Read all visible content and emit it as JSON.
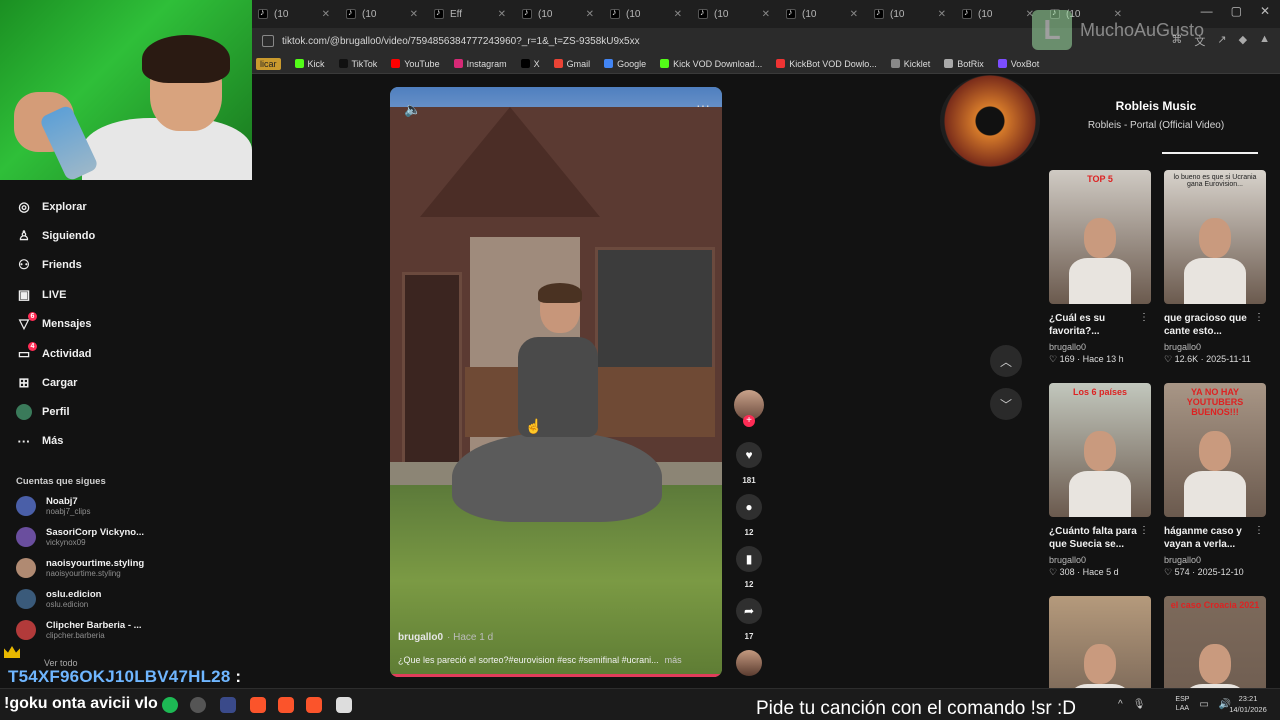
{
  "browser": {
    "tab_label": "(10",
    "tab_special_label": "Eff",
    "url": "tiktok.com/@brugallo0/video/7594856384777243960?_r=1&_t=ZS-9358kU9x5xx",
    "bookmarks": [
      "licar",
      "Kick",
      "TikTok",
      "YouTube",
      "Instagram",
      "X",
      "Gmail",
      "Google",
      "Kick VOD Download...",
      "KickBot VOD Dowlo...",
      "Kicklet",
      "BotRix",
      "VoxBot"
    ]
  },
  "sidebar": {
    "nav": [
      "Explorar",
      "Siguiendo",
      "Friends",
      "LIVE",
      "Mensajes",
      "Actividad",
      "Cargar",
      "Perfil",
      "Más"
    ],
    "badges": {
      "mensajes": "6",
      "actividad": "4"
    },
    "follow_title": "Cuentas que sigues",
    "following": [
      {
        "name": "Noabj7",
        "handle": "noabj7_clips",
        "color": "#4a5fa8"
      },
      {
        "name": "SasoriCorp Vickyno...",
        "handle": "vickynox09",
        "color": "#6a4e9e"
      },
      {
        "name": "naoisyourtime.styling",
        "handle": "naoisyourtime.styling",
        "color": "#b08a72"
      },
      {
        "name": "oslu.edicion",
        "handle": "oslu.edicion",
        "color": "#3a5a7a"
      },
      {
        "name": "Clipcher Barberia - ...",
        "handle": "clipcher.barberia",
        "color": "#b23a3a"
      }
    ],
    "see_all": "Ver todo"
  },
  "video": {
    "author": "brugallo0",
    "author_sub": "· Hace 1 d",
    "caption": "¿Que les pareció el sorteo?#eurovision #esc #semifinal #ucrani...",
    "more_label": "más"
  },
  "actions": {
    "likes": "181",
    "comments": "12",
    "saves": "12",
    "shares": "17"
  },
  "music": {
    "title": "Robleis Music",
    "subtitle": "Robleis - Portal (Official Video)"
  },
  "grid": [
    {
      "title": "¿Cuál es su favorita?...",
      "author": "brugallo0",
      "meta": "♡ 169 · Hace 13 h",
      "thumb_text": "TOP 5",
      "thumb_color": "#cfcac3",
      "text_style": "red"
    },
    {
      "title": "que gracioso que cante esto...",
      "author": "brugallo0",
      "meta": "♡ 12.6K · 2025-11-11",
      "thumb_text": "lo bueno es que si Ucrania gana Eurovision...",
      "thumb_color": "#d8d3cc",
      "text_style": "white"
    },
    {
      "title": "¿Cuánto falta para que Suecia se...",
      "author": "brugallo0",
      "meta": "♡ 308 · Hace 5 d",
      "thumb_text": "Los 6 países",
      "thumb_color": "#c2c7bd",
      "text_style": "red"
    },
    {
      "title": "háganme caso y vayan a verla...",
      "author": "brugallo0",
      "meta": "♡ 574 · 2025-12-10",
      "thumb_text": "YA NO HAY YOUTUBERS BUENOS!!!",
      "thumb_color": "#a89686",
      "text_style": "red"
    },
    {
      "title": "",
      "author": "",
      "meta": "",
      "thumb_text": "",
      "thumb_color": "#b59a7c",
      "text_style": "white"
    },
    {
      "title": "",
      "author": "",
      "meta": "",
      "thumb_text": "el caso Croacia 2021",
      "thumb_color": "#7d6a5b",
      "text_style": "red"
    }
  ],
  "watermark": "MuchoAuGusto",
  "overlay": {
    "code": "T54XF96OKJ10LBV47HL28",
    "code_suffix": " :",
    "chat_line": "!goku onta avicii vlo",
    "command": "Pide tu canción con el comando !sr :D"
  },
  "tray": {
    "lang_top": "ESP",
    "lang_bottom": "LAA",
    "time": "23:21",
    "date": "14/01/2026"
  }
}
